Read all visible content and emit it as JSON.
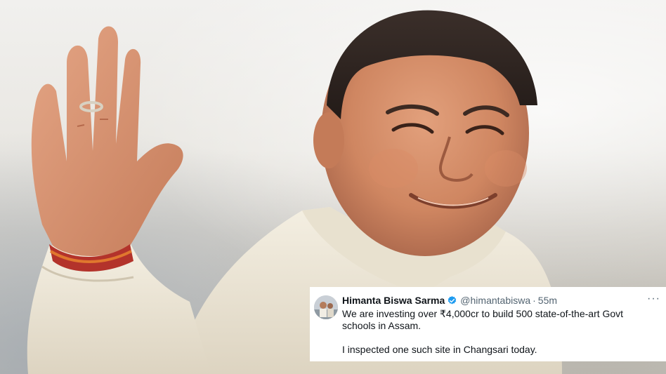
{
  "tweet": {
    "author_name": "Himanta Biswa Sarma",
    "handle": "@himantabiswa",
    "separator": "·",
    "time": "55m",
    "more_icon": "ellipsis-icon",
    "verified_icon": "verified-badge-icon",
    "verified_color": "#1d9bf0",
    "text_line1": "We are investing over ₹4,000cr to build 500 state-of-the-art Govt schools in Assam.",
    "text_line2": "I inspected one such site in Changsari today."
  },
  "photo": {
    "subject": "smiling-man-waving"
  }
}
